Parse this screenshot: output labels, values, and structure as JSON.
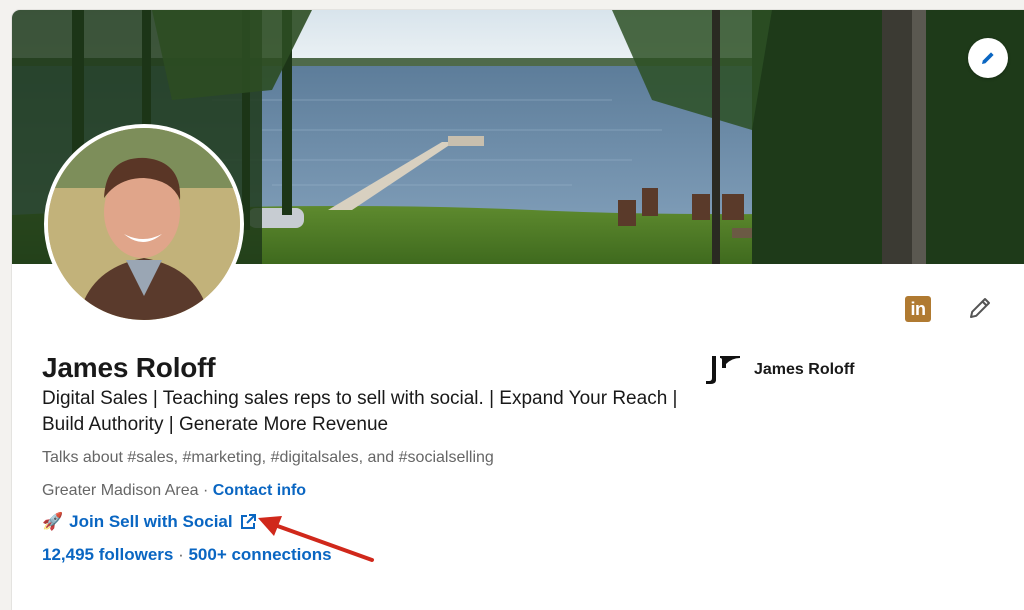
{
  "profile": {
    "name": "James Roloff",
    "headline": "Digital Sales | Teaching sales reps to sell with social. | Expand Your Reach | Build Authority | Generate More Revenue",
    "talks_about": "Talks about #sales, #marketing, #digitalsales, and #socialselling",
    "location": "Greater Madison Area",
    "separator": " · ",
    "contact_info_label": "Contact info",
    "website_emoji": "🚀",
    "website_label": "Join Sell with Social",
    "followers": "12,495 followers",
    "stats_separator": " · ",
    "connections": "500+ connections"
  },
  "company": {
    "name": "James Roloff"
  },
  "actions": {
    "linkedin_badge": "in"
  },
  "icons": {
    "edit_cover": "pencil-icon",
    "edit_intro": "pencil-icon",
    "external_link": "external-link-icon",
    "company_logo": "jr-logo-icon"
  },
  "colors": {
    "link": "#0a66c2",
    "badge": "#b07a31",
    "annotation_arrow": "#d0281b"
  }
}
